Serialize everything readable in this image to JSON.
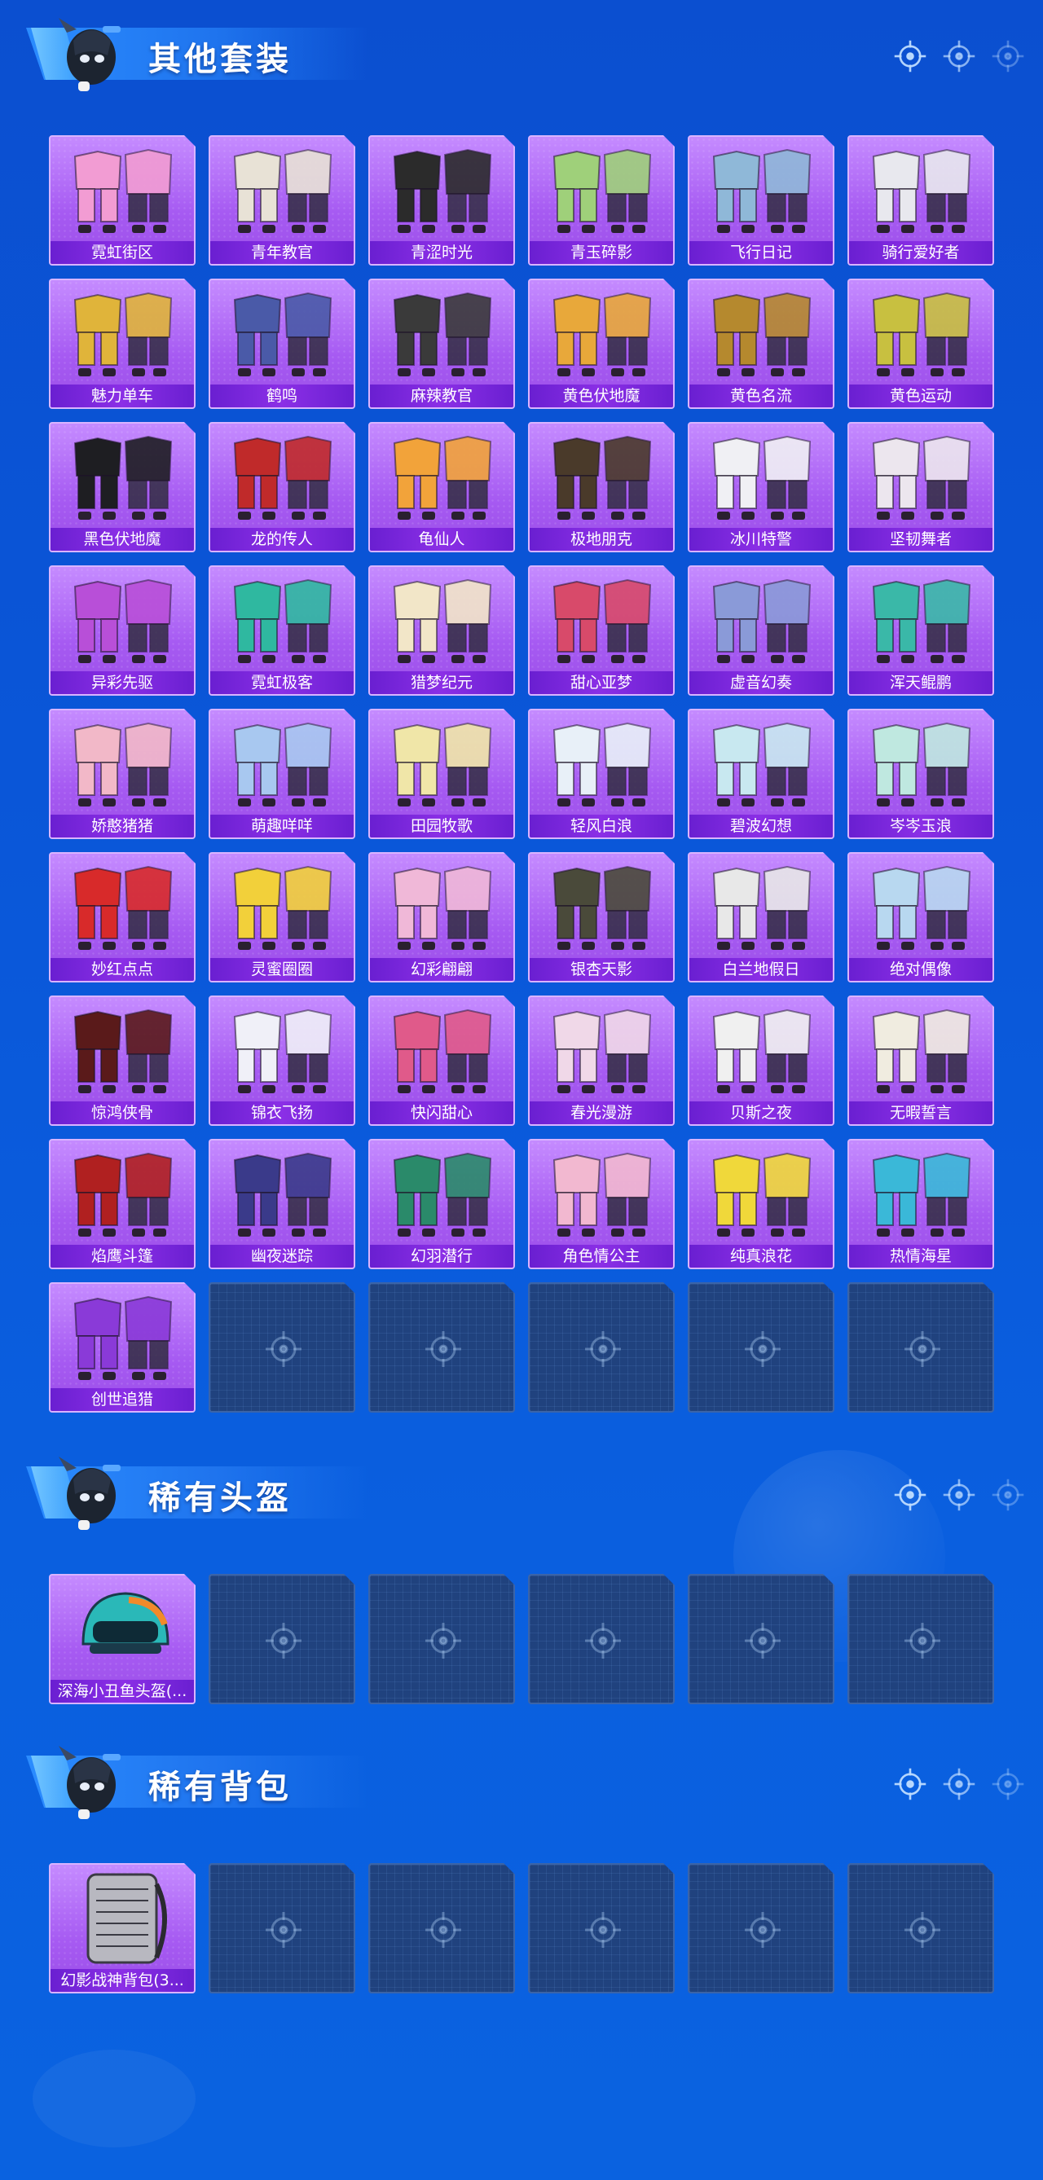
{
  "colors": {
    "background": "#0b4fd0",
    "card_purple": "#a65af2",
    "label_purple": "#6a1fd1",
    "empty_slot": "#20427e",
    "title_text": "#ffffff"
  },
  "sections": [
    {
      "title": "其他套装",
      "items": [
        {
          "label": "霓虹街区",
          "icon": "outfit-icon",
          "hue": "#f29cd3"
        },
        {
          "label": "青年教官",
          "icon": "outfit-icon",
          "hue": "#e8e2d6"
        },
        {
          "label": "青涩时光",
          "icon": "outfit-icon",
          "hue": "#2b2b2b"
        },
        {
          "label": "青玉碎影",
          "icon": "outfit-icon",
          "hue": "#9fd07a"
        },
        {
          "label": "飞行日记",
          "icon": "outfit-icon",
          "hue": "#8fb8d8"
        },
        {
          "label": "骑行爱好者",
          "icon": "outfit-icon",
          "hue": "#e8e8ee"
        },
        {
          "label": "魅力单车",
          "icon": "outfit-icon",
          "hue": "#e0b43a"
        },
        {
          "label": "鹤鸣",
          "icon": "outfit-icon",
          "hue": "#4a5aa8"
        },
        {
          "label": "麻辣教官",
          "icon": "outfit-icon",
          "hue": "#3a3a3a"
        },
        {
          "label": "黄色伏地魔",
          "icon": "outfit-icon",
          "hue": "#e8a83a"
        },
        {
          "label": "黄色名流",
          "icon": "outfit-icon",
          "hue": "#b5892e"
        },
        {
          "label": "黄色运动",
          "icon": "outfit-icon",
          "hue": "#c8c040"
        },
        {
          "label": "黑色伏地魔",
          "icon": "outfit-icon",
          "hue": "#1e1e22"
        },
        {
          "label": "龙的传人",
          "icon": "outfit-icon",
          "hue": "#c02a2a"
        },
        {
          "label": "龟仙人",
          "icon": "outfit-icon",
          "hue": "#f2a33a"
        },
        {
          "label": "极地朋克",
          "icon": "outfit-icon",
          "hue": "#4a3a2a"
        },
        {
          "label": "冰川特警",
          "icon": "outfit-icon",
          "hue": "#f0f0f4"
        },
        {
          "label": "坚韧舞者",
          "icon": "outfit-icon",
          "hue": "#ece6ee"
        },
        {
          "label": "异彩先驱",
          "icon": "outfit-icon",
          "hue": "#b84fd8"
        },
        {
          "label": "霓虹极客",
          "icon": "outfit-icon",
          "hue": "#2fb8a0"
        },
        {
          "label": "猎梦纪元",
          "icon": "outfit-icon",
          "hue": "#f2e6c8"
        },
        {
          "label": "甜心亚梦",
          "icon": "outfit-icon",
          "hue": "#d84a6a"
        },
        {
          "label": "虚音幻奏",
          "icon": "outfit-icon",
          "hue": "#8a9ad8"
        },
        {
          "label": "浑天鲲鹏",
          "icon": "outfit-icon",
          "hue": "#3ab8a8"
        },
        {
          "label": "娇憨猪猪",
          "icon": "outfit-icon",
          "hue": "#f2b8c8"
        },
        {
          "label": "萌趣咩咩",
          "icon": "outfit-icon",
          "hue": "#a8c8f0"
        },
        {
          "label": "田园牧歌",
          "icon": "outfit-icon",
          "hue": "#f0e6a8"
        },
        {
          "label": "轻风白浪",
          "icon": "outfit-icon",
          "hue": "#e8f0f8"
        },
        {
          "label": "碧波幻想",
          "icon": "outfit-icon",
          "hue": "#c8e8f0"
        },
        {
          "label": "岑岑玉浪",
          "icon": "outfit-icon",
          "hue": "#bfe8e0"
        },
        {
          "label": "妙红点点",
          "icon": "outfit-icon",
          "hue": "#d82a2a"
        },
        {
          "label": "灵蜜圈圈",
          "icon": "outfit-icon",
          "hue": "#f2d03a"
        },
        {
          "label": "幻彩翩翩",
          "icon": "outfit-icon",
          "hue": "#f0b8d8"
        },
        {
          "label": "银杏天影",
          "icon": "outfit-icon",
          "hue": "#4a4a3a"
        },
        {
          "label": "白兰地假日",
          "icon": "outfit-icon",
          "hue": "#e8e8e8"
        },
        {
          "label": "绝对偶像",
          "icon": "outfit-icon",
          "hue": "#b8d8f0"
        },
        {
          "label": "惊鸿侠骨",
          "icon": "outfit-icon",
          "hue": "#5a1a1a"
        },
        {
          "label": "锦衣飞扬",
          "icon": "outfit-icon",
          "hue": "#f0f0f8"
        },
        {
          "label": "快闪甜心",
          "icon": "outfit-icon",
          "hue": "#e05a8a"
        },
        {
          "label": "春光漫游",
          "icon": "outfit-icon",
          "hue": "#f0d8e8"
        },
        {
          "label": "贝斯之夜",
          "icon": "outfit-icon",
          "hue": "#f0f0f0"
        },
        {
          "label": "无暇誓言",
          "icon": "outfit-icon",
          "hue": "#f0ece0"
        },
        {
          "label": "焰鹰斗篷",
          "icon": "outfit-icon",
          "hue": "#b02020"
        },
        {
          "label": "幽夜迷踪",
          "icon": "outfit-icon",
          "hue": "#3a3a8a"
        },
        {
          "label": "幻羽潜行",
          "icon": "outfit-icon",
          "hue": "#2a8a6a"
        },
        {
          "label": "角色情公主",
          "icon": "outfit-icon",
          "hue": "#f2b8d0"
        },
        {
          "label": "纯真浪花",
          "icon": "outfit-icon",
          "hue": "#f0d83a"
        },
        {
          "label": "热情海星",
          "icon": "outfit-icon",
          "hue": "#3ab8d8"
        },
        {
          "label": "创世追猎",
          "icon": "outfit-icon",
          "hue": "#8a3ad8"
        }
      ],
      "empty_slots": 5
    },
    {
      "title": "稀有头盔",
      "items": [
        {
          "label": "深海小丑鱼头盔(...",
          "icon": "helmet-icon",
          "hue": "#2ab8b8"
        }
      ],
      "empty_slots": 5
    },
    {
      "title": "稀有背包",
      "items": [
        {
          "label": "幻影战神背包(3...",
          "icon": "backpack-icon",
          "hue": "#b8b8c0"
        }
      ],
      "empty_slots": 5
    }
  ]
}
